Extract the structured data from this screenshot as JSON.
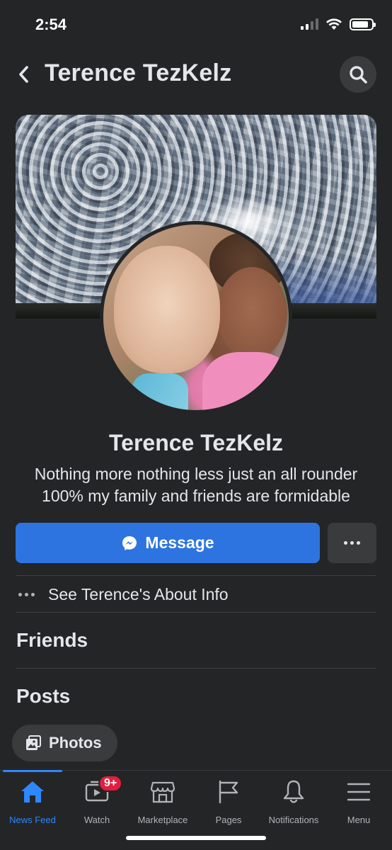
{
  "status_bar": {
    "time": "2:54",
    "battery_level": 0.85
  },
  "header": {
    "title": "Terence TezKelz",
    "back_icon": "chevron-left-icon",
    "search_icon": "search-icon"
  },
  "profile": {
    "name": "Terence TezKelz",
    "bio": "Nothing more nothing less just an all rounder 100% my family and friends are formidable"
  },
  "actions": {
    "message_label": "Message",
    "message_icon": "messenger-icon",
    "more_icon": "more-horizontal-icon"
  },
  "about": {
    "label": "See Terence's About Info"
  },
  "sections": {
    "friends": "Friends",
    "posts": "Posts"
  },
  "photos_chip": {
    "label": "Photos",
    "icon": "photos-icon"
  },
  "bottom_nav": {
    "items": [
      {
        "label": "News Feed",
        "icon": "home-icon",
        "active": true
      },
      {
        "label": "Watch",
        "icon": "watch-icon",
        "badge": "9+"
      },
      {
        "label": "Marketplace",
        "icon": "marketplace-icon"
      },
      {
        "label": "Pages",
        "icon": "pages-flag-icon"
      },
      {
        "label": "Notifications",
        "icon": "bell-icon"
      },
      {
        "label": "Menu",
        "icon": "menu-icon"
      }
    ]
  },
  "colors": {
    "background": "#242526",
    "accent": "#2d74e0",
    "active_nav": "#2d88ff",
    "badge": "#e41e3f"
  }
}
